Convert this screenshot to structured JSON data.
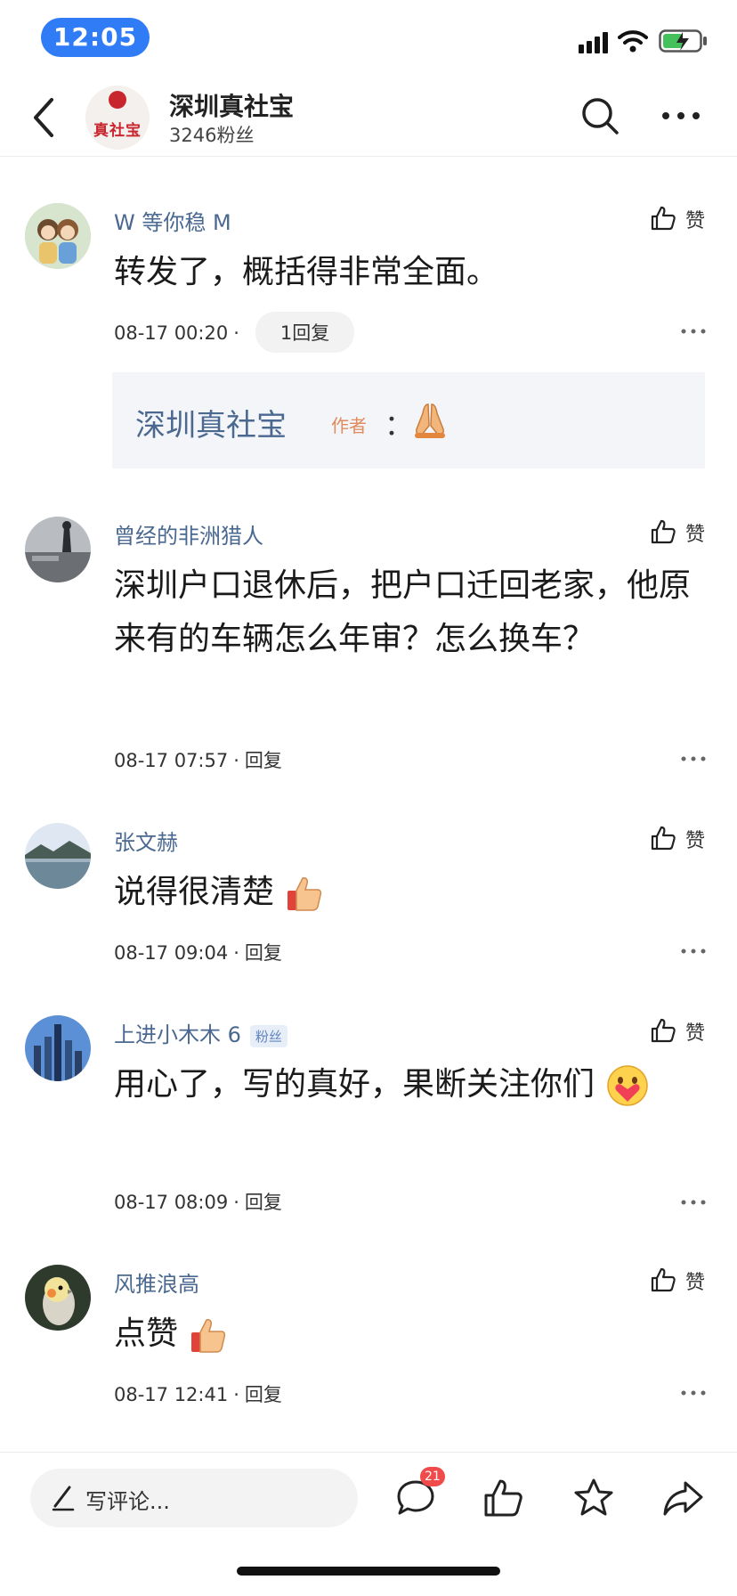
{
  "status_bar": {
    "time": "12:05"
  },
  "header": {
    "account_name": "深圳真社宝",
    "followers": "3246粉丝",
    "logo_text": "真社宝"
  },
  "like_label": "赞",
  "comments": [
    {
      "username": "W 等你稳 M",
      "text": "转发了，概括得非常全面。",
      "timestamp": "08-17 00:20",
      "reply_label": "1回复",
      "author_reply": {
        "name": "深圳真社宝",
        "tag": "作者",
        "colon": "："
      }
    },
    {
      "username": "曾经的非洲猎人",
      "text": "深圳户口退休后，把户口迁回老家，他原来有的车辆怎么年审？怎么换车？",
      "timestamp": "08-17 07:57",
      "reply_label": "回复"
    },
    {
      "username": "张文赫",
      "text": "说得很清楚",
      "timestamp": "08-17 09:04",
      "reply_label": "回复"
    },
    {
      "username": "上进小木木 6",
      "badge": "粉丝",
      "text": "用心了，写的真好，果断关注你们",
      "timestamp": "08-17 08:09",
      "reply_label": "回复"
    },
    {
      "username": "风推浪高",
      "text": "点赞",
      "timestamp": "08-17 12:41",
      "reply_label": "回复"
    }
  ],
  "bottom_bar": {
    "input_placeholder": "写评论...",
    "comment_count": "21"
  },
  "colors": {
    "accent_blue": "#2f7cf6",
    "username": "#4a6890",
    "brand_red": "#c8252c",
    "badge_red": "#f04a4a"
  }
}
